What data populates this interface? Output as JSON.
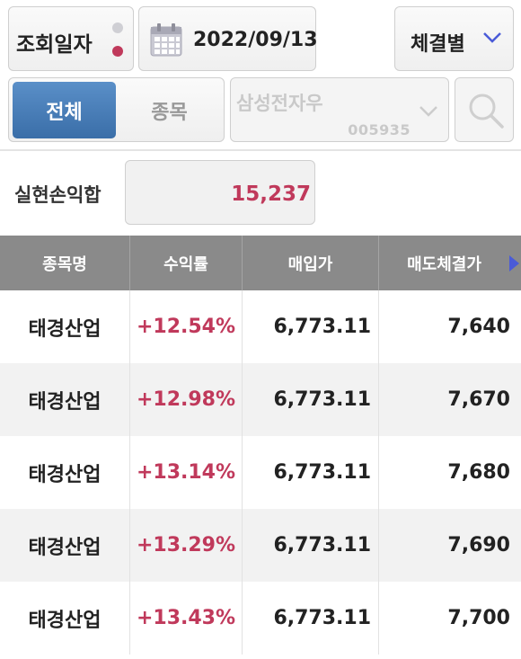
{
  "header": {
    "query_date_label": "조회일자",
    "date_value": "2022/09/13",
    "sort_label": "체결별"
  },
  "filter": {
    "tab_all": "전체",
    "tab_stock": "종목",
    "stock_name_placeholder": "삼성전자우",
    "stock_code_placeholder": "005935"
  },
  "summary": {
    "label": "실현손익합",
    "value": "15,237",
    "value_color": "#c0395b"
  },
  "table": {
    "columns": [
      "종목명",
      "수익률",
      "매입가",
      "매도체결가"
    ],
    "rows": [
      {
        "name": "태경산업",
        "rate": "+12.54%",
        "buy_price": "6,773.11",
        "sell_price": "7,640"
      },
      {
        "name": "태경산업",
        "rate": "+12.98%",
        "buy_price": "6,773.11",
        "sell_price": "7,670"
      },
      {
        "name": "태경산업",
        "rate": "+13.14%",
        "buy_price": "6,773.11",
        "sell_price": "7,680"
      },
      {
        "name": "태경산업",
        "rate": "+13.29%",
        "buy_price": "6,773.11",
        "sell_price": "7,690"
      },
      {
        "name": "태경산업",
        "rate": "+13.43%",
        "buy_price": "6,773.11",
        "sell_price": "7,700"
      }
    ]
  },
  "colors": {
    "accent_blue": "#3a6ea8",
    "positive_red": "#c0395b",
    "header_gray": "#8a8a8a"
  },
  "icons": [
    "calendar-icon",
    "chevron-down-icon",
    "search-icon",
    "scroll-right-icon"
  ]
}
